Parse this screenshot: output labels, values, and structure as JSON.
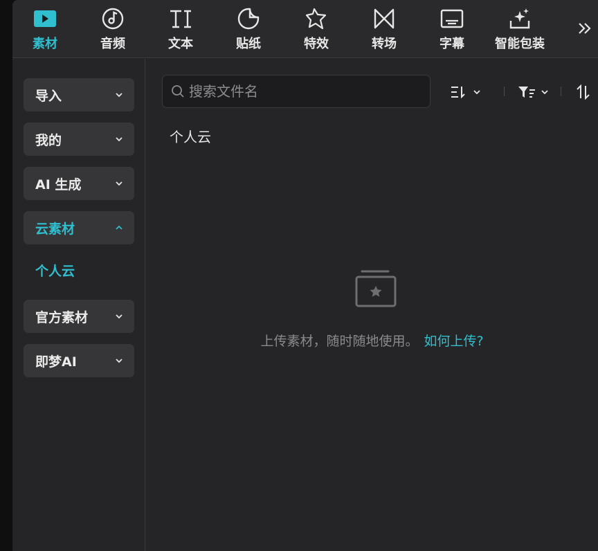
{
  "toolbar": {
    "items": [
      {
        "label": "素材",
        "icon": "media-play-icon",
        "active": true
      },
      {
        "label": "音频",
        "icon": "audio-icon",
        "active": false
      },
      {
        "label": "文本",
        "icon": "text-icon",
        "active": false
      },
      {
        "label": "贴纸",
        "icon": "sticker-icon",
        "active": false
      },
      {
        "label": "特效",
        "icon": "effects-star-icon",
        "active": false
      },
      {
        "label": "转场",
        "icon": "transition-icon",
        "active": false
      },
      {
        "label": "字幕",
        "icon": "subtitle-icon",
        "active": false
      },
      {
        "label": "智能包装",
        "icon": "smart-package-icon",
        "active": false
      }
    ],
    "more_icon": "double-chevron-right-icon"
  },
  "sidebar": {
    "categories": [
      {
        "label": "导入",
        "expanded": false
      },
      {
        "label": "我的",
        "expanded": false
      },
      {
        "label": "AI 生成",
        "expanded": false
      },
      {
        "label": "云素材",
        "expanded": true
      },
      {
        "label": "官方素材",
        "expanded": false
      },
      {
        "label": "即梦AI",
        "expanded": false
      }
    ],
    "sub_item": "个人云"
  },
  "main": {
    "search_placeholder": "搜索文件名",
    "folder_label": "个人云",
    "empty_text": "上传素材，随时随地使用。",
    "empty_link": "如何上传?"
  },
  "colors": {
    "accent": "#2fbfcf",
    "panel_bg": "#252527",
    "tile_bg": "#363638"
  }
}
